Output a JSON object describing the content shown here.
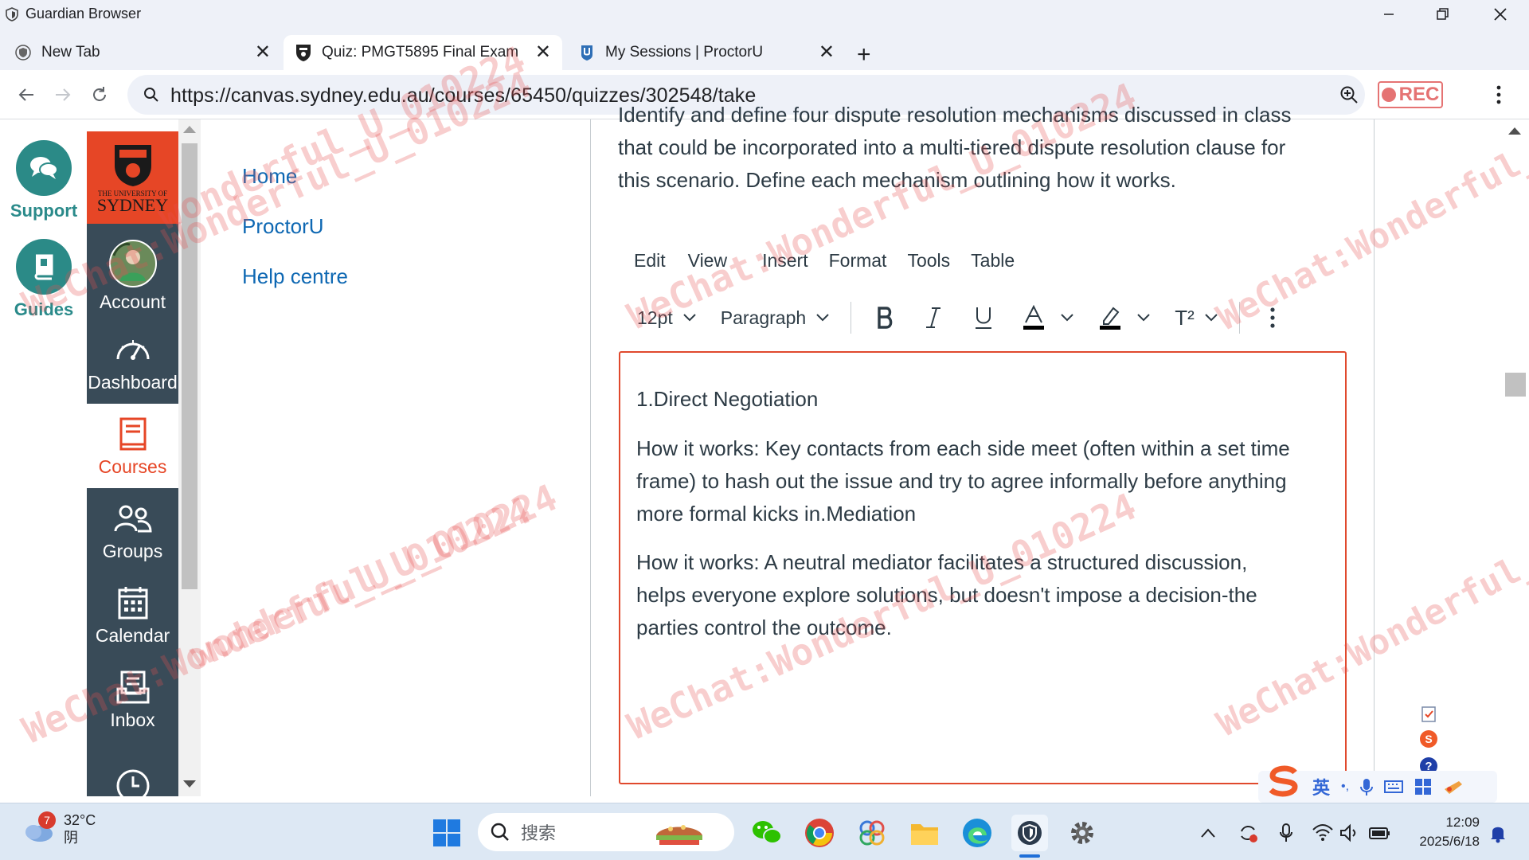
{
  "browser": {
    "app_title": "Guardian Browser",
    "tabs": [
      {
        "label": "New Tab",
        "active": false
      },
      {
        "label": "Quiz: PMGT5895 Final Exam",
        "active": true
      },
      {
        "label": "My Sessions | ProctorU",
        "active": false
      }
    ],
    "url": "https://canvas.sydney.edu.au/courses/65450/quizzes/302548/take",
    "rec_label": "REC"
  },
  "helpers": {
    "support_label": "Support",
    "guides_label": "Guides"
  },
  "logo": {
    "line1": "THE UNIVERSITY OF",
    "line2": "SYDNEY"
  },
  "global_nav": [
    {
      "label": "Account",
      "icon": "avatar"
    },
    {
      "label": "Dashboard",
      "icon": "dashboard-icon"
    },
    {
      "label": "Courses",
      "icon": "courses-icon"
    },
    {
      "label": "Groups",
      "icon": "groups-icon"
    },
    {
      "label": "Calendar",
      "icon": "calendar-icon"
    },
    {
      "label": "Inbox",
      "icon": "inbox-icon"
    }
  ],
  "course_nav": [
    {
      "label": "Home"
    },
    {
      "label": "ProctorU"
    },
    {
      "label": "Help centre"
    }
  ],
  "question": {
    "line1": "Identify and define four dispute resolution mechanisms discussed in class",
    "line2": "that could be incorporated into a multi-tiered dispute resolution clause for",
    "line3": "this scenario. Define each mechanism outlining how it works."
  },
  "editor_menu": [
    "Edit",
    "View",
    "Insert",
    "Format",
    "Tools",
    "Table"
  ],
  "editor_toolbar": {
    "font_size": "12pt",
    "block_format": "Paragraph",
    "superscript_label": "T²"
  },
  "editor_content": {
    "p1": "1.Direct Negotiation",
    "p2a": "How it works: Key contacts from each side meet (often within a set time",
    "p2b": "frame) to hash out the issue and try to agree informally before anything",
    "p2c": "more formal kicks in.Mediation",
    "p3a": "How it works: A neutral mediator facilitates a structured discussion,",
    "p3b": "helps everyone explore solutions, but doesn't impose a decision-the",
    "p3c": "parties control the outcome."
  },
  "ime": {
    "lang": "英",
    "punct": "•,"
  },
  "taskbar": {
    "weather_badge": "7",
    "temperature": "32°C",
    "condition": "阴",
    "search_placeholder": "搜索",
    "time": "12:09",
    "date": "2025/6/18"
  },
  "watermark": {
    "text_a": "wonderful_U_010224",
    "text_b": "WeChat:Wonderful_U_010224"
  },
  "colors": {
    "canvas_nav": "#394b58",
    "brand_red": "#e64626",
    "link_blue": "#0e68b3",
    "support_teal": "#2b8a87"
  }
}
